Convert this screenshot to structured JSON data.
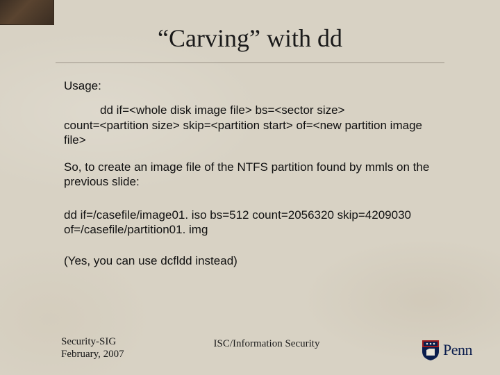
{
  "title": "“Carving” with dd",
  "usage_label": "Usage:",
  "usage_line1": "dd if=<whole disk image file> bs=<sector size>",
  "usage_line2": "count=<partition size> skip=<partition start> of=<new partition image file>",
  "explain": "So, to create an image file of the NTFS partition found by mmls on the previous slide:",
  "command_line1": "dd if=/casefile/image01. iso bs=512 count=2056320 skip=4209030",
  "command_line2": "of=/casefile/partition01. img",
  "aside": "(Yes, you can use dcfldd instead)",
  "footer_left_1": "Security-SIG",
  "footer_left_2": "February, 2007",
  "footer_center": "ISC/Information Security",
  "logo_text": "Penn",
  "colors": {
    "background": "#d8d2c4",
    "penn_blue": "#0a1d4d",
    "penn_red": "#9a1b1e",
    "corner_brown": "#3a2d22"
  }
}
